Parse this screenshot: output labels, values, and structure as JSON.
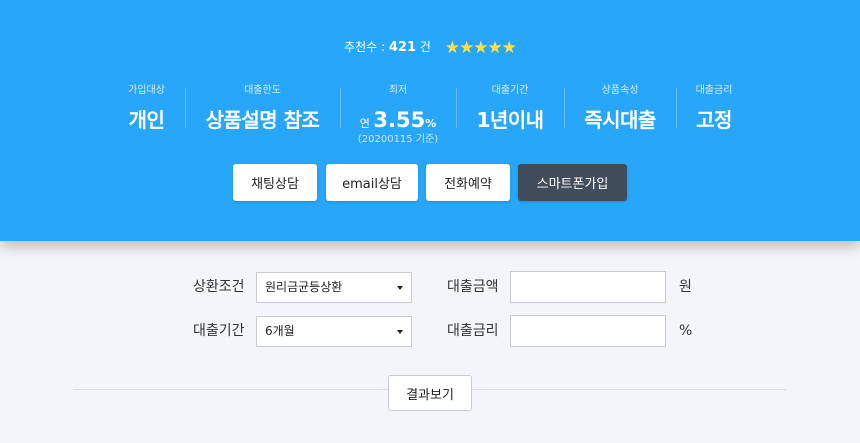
{
  "header": {
    "recommend_label": "추천수 : ",
    "recommend_count": "421",
    "recommend_unit": " 건",
    "stars": "★★★★★",
    "rating_stars": 5,
    "star_color": "#ffe23c"
  },
  "stats": [
    {
      "label": "가입대상",
      "value": "개인"
    },
    {
      "label": "대출한도",
      "value": "상품설명 참조"
    },
    {
      "label": "최저",
      "prefix": "연 ",
      "rate": "3.55",
      "rate_unit": "%",
      "note": "(20200115 기준)"
    },
    {
      "label": "대출기간",
      "value": "1년이내"
    },
    {
      "label": "상품속성",
      "value": "즉시대출"
    },
    {
      "label": "대출금리",
      "value": "고정"
    }
  ],
  "buttons": {
    "chat": "채팅상담",
    "email": "email상담",
    "phone": "전화예약",
    "smartphone": "스마트폰가입"
  },
  "form": {
    "repayment_label": "상환조건",
    "repayment_selected": "원리금균등상환",
    "loan_amount_label": "대출금액",
    "loan_amount_value": "",
    "loan_amount_unit": "원",
    "period_label": "대출기간",
    "period_selected": "6개월",
    "interest_label": "대출금리",
    "interest_value": "",
    "interest_unit": "%",
    "result_button": "결과보기"
  },
  "colors": {
    "hero_bg": "#27a6fa",
    "primary_button": "#424d5c",
    "page_bg": "#f4f5f8"
  }
}
